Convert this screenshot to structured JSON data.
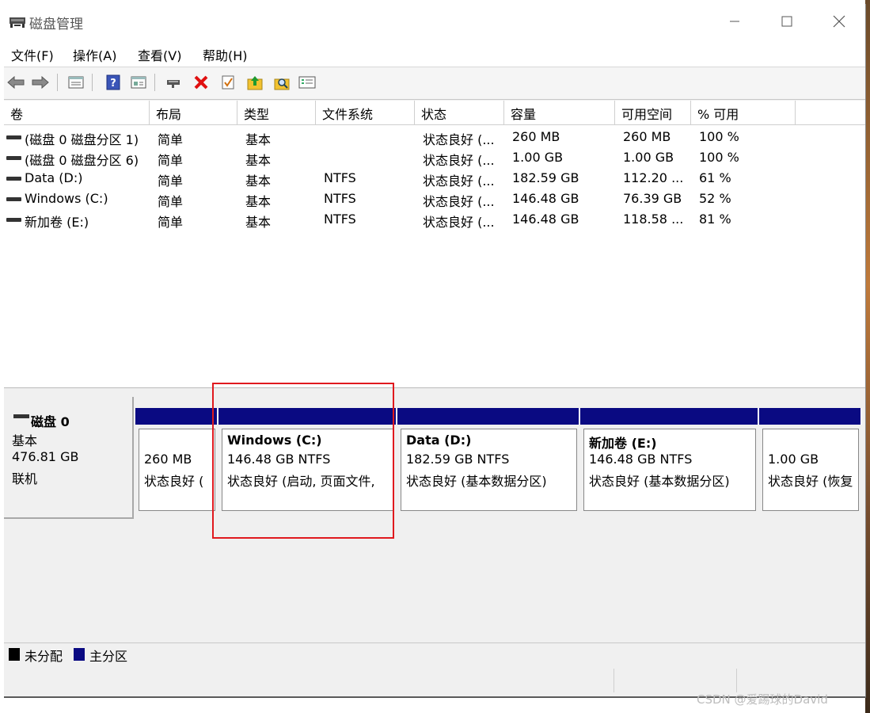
{
  "window": {
    "title": "磁盘管理"
  },
  "menu": [
    "文件(F)",
    "操作(A)",
    "查看(V)",
    "帮助(H)"
  ],
  "toolbar": {
    "icons": [
      "back-arrow-icon",
      "forward-arrow-icon",
      "properties-icon",
      "help-icon",
      "list-view-icon",
      "connect-icon",
      "delete-icon",
      "check-icon",
      "up-icon",
      "search-icon",
      "settings-icon"
    ]
  },
  "volume_list": {
    "columns": [
      "卷",
      "布局",
      "类型",
      "文件系统",
      "状态",
      "容量",
      "可用空间",
      "% 可用"
    ],
    "rows": [
      [
        "(磁盘 0 磁盘分区 1)",
        "简单",
        "基本",
        "",
        "状态良好 (...",
        "260 MB",
        "260 MB",
        "100 %"
      ],
      [
        "(磁盘 0 磁盘分区 6)",
        "简单",
        "基本",
        "",
        "状态良好 (...",
        "1.00 GB",
        "1.00 GB",
        "100 %"
      ],
      [
        "Data (D:)",
        "简单",
        "基本",
        "NTFS",
        "状态良好 (...",
        "182.59 GB",
        "112.20 ...",
        "61 %"
      ],
      [
        "Windows (C:)",
        "简单",
        "基本",
        "NTFS",
        "状态良好 (...",
        "146.48 GB",
        "76.39 GB",
        "52 %"
      ],
      [
        "新加卷 (E:)",
        "简单",
        "基本",
        "NTFS",
        "状态良好 (...",
        "146.48 GB",
        "118.58 ...",
        "81 %"
      ]
    ]
  },
  "disk": {
    "name": "磁盘 0",
    "type": "基本",
    "size": "476.81 GB",
    "state": "联机",
    "partitions": [
      {
        "title": "",
        "line1": "260 MB",
        "line2": "状态良好 ("
      },
      {
        "title": "Windows  (C:)",
        "line1": "146.48 GB NTFS",
        "line2": "状态良好 (启动, 页面文件,"
      },
      {
        "title": "Data  (D:)",
        "line1": "182.59 GB NTFS",
        "line2": "状态良好 (基本数据分区)"
      },
      {
        "title": "新加卷  (E:)",
        "line1": "146.48 GB NTFS",
        "line2": "状态良好 (基本数据分区)"
      },
      {
        "title": "",
        "line1": "1.00 GB",
        "line2": "状态良好 (恢复"
      }
    ]
  },
  "legend": [
    {
      "label": "未分配",
      "color": "#000000"
    },
    {
      "label": "主分区",
      "color": "#0a0a82"
    }
  ],
  "watermark": "CSDN @爱踢球的David",
  "colors": {
    "primary_partition": "#0a0a82",
    "highlight": "#e0191e"
  }
}
